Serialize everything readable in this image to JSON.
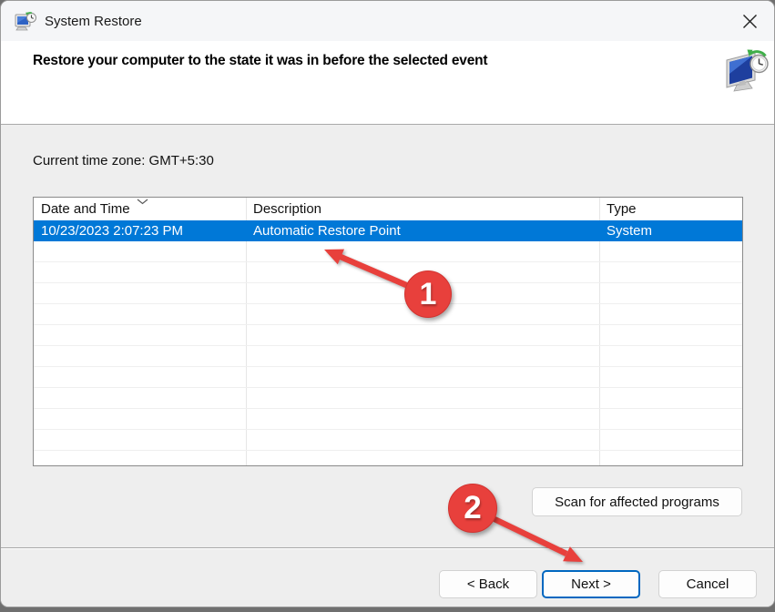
{
  "window": {
    "title": "System Restore"
  },
  "header": {
    "instruction": "Restore your computer to the state it was in before the selected event"
  },
  "main": {
    "timezone_label": "Current time zone: GMT+5:30"
  },
  "table": {
    "columns": [
      {
        "label": "Date and Time",
        "sorted": "descending"
      },
      {
        "label": "Description"
      },
      {
        "label": "Type"
      }
    ],
    "rows": [
      {
        "date_time": "10/23/2023 2:07:23 PM",
        "description": "Automatic Restore Point",
        "type": "System",
        "selected": true
      }
    ]
  },
  "buttons": {
    "scan": "Scan for affected programs",
    "back": "< Back",
    "next": "Next >",
    "cancel": "Cancel"
  },
  "annotations": [
    {
      "number": "1",
      "points_at": "selected restore point row"
    },
    {
      "number": "2",
      "points_at": "Next button"
    }
  ],
  "icons": {
    "titlebar": "system-restore (monitor with clock)",
    "header": "system-restore large (monitor with clock and green arrow)",
    "close": "✕",
    "sort": "chevron-down"
  },
  "colors": {
    "selection_blue": "#0078d7",
    "annotation_red": "#e8403c",
    "next_button_border": "#0067c0",
    "titlebar_bg": "#f5f6f8",
    "body_bg": "#eeeeee"
  }
}
